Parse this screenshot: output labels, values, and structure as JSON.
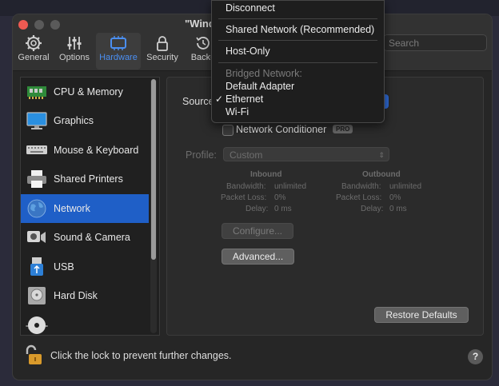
{
  "window": {
    "title": "\"Wind"
  },
  "toolbar": {
    "items": [
      {
        "label": "General",
        "icon": "gear-icon"
      },
      {
        "label": "Options",
        "icon": "sliders-icon"
      },
      {
        "label": "Hardware",
        "icon": "hardware-icon",
        "active": true
      },
      {
        "label": "Security",
        "icon": "lock-icon"
      },
      {
        "label": "Backu",
        "icon": "backup-clock-icon"
      }
    ],
    "search_placeholder": "Search"
  },
  "sidebar": {
    "items": [
      {
        "label": "CPU & Memory",
        "icon": "cpu-memory-icon"
      },
      {
        "label": "Graphics",
        "icon": "monitor-icon"
      },
      {
        "label": "Mouse & Keyboard",
        "icon": "keyboard-icon"
      },
      {
        "label": "Shared Printers",
        "icon": "printer-icon"
      },
      {
        "label": "Network",
        "icon": "globe-icon",
        "selected": true
      },
      {
        "label": "Sound & Camera",
        "icon": "camera-speaker-icon"
      },
      {
        "label": "USB",
        "icon": "usb-icon"
      },
      {
        "label": "Hard Disk",
        "icon": "hard-disk-icon"
      }
    ],
    "add_label": "+",
    "remove_label": "−"
  },
  "network": {
    "source_label": "Source",
    "network_conditioner_label": "Network Conditioner",
    "pro_badge": "PRO",
    "profile_label": "Profile:",
    "profile_value": "Custom",
    "inbound": {
      "title": "Inbound",
      "bandwidth_label": "Bandwidth:",
      "bandwidth_value": "unlimited",
      "packet_loss_label": "Packet Loss:",
      "packet_loss_value": "0%",
      "delay_label": "Delay:",
      "delay_value": "0 ms"
    },
    "outbound": {
      "title": "Outbound",
      "bandwidth_label": "Bandwidth:",
      "bandwidth_value": "unlimited",
      "packet_loss_label": "Packet Loss:",
      "packet_loss_value": "0%",
      "delay_label": "Delay:",
      "delay_value": "0 ms"
    },
    "configure_label": "Configure...",
    "advanced_label": "Advanced...",
    "restore_defaults_label": "Restore Defaults"
  },
  "footer": {
    "lock_text": "Click the lock to prevent further changes.",
    "help_label": "?"
  },
  "source_menu": {
    "disconnect": "Disconnect",
    "shared": "Shared Network (Recommended)",
    "host_only": "Host-Only",
    "bridged_header": "Bridged Network:",
    "default_adapter": "Default Adapter",
    "ethernet": "Ethernet",
    "wifi": "Wi-Fi",
    "selected": "Ethernet",
    "checkmark": "✓"
  },
  "colors": {
    "accent": "#1f5fc7",
    "selection_blue": "#4b8ff2",
    "close_red": "#ee5a52"
  }
}
